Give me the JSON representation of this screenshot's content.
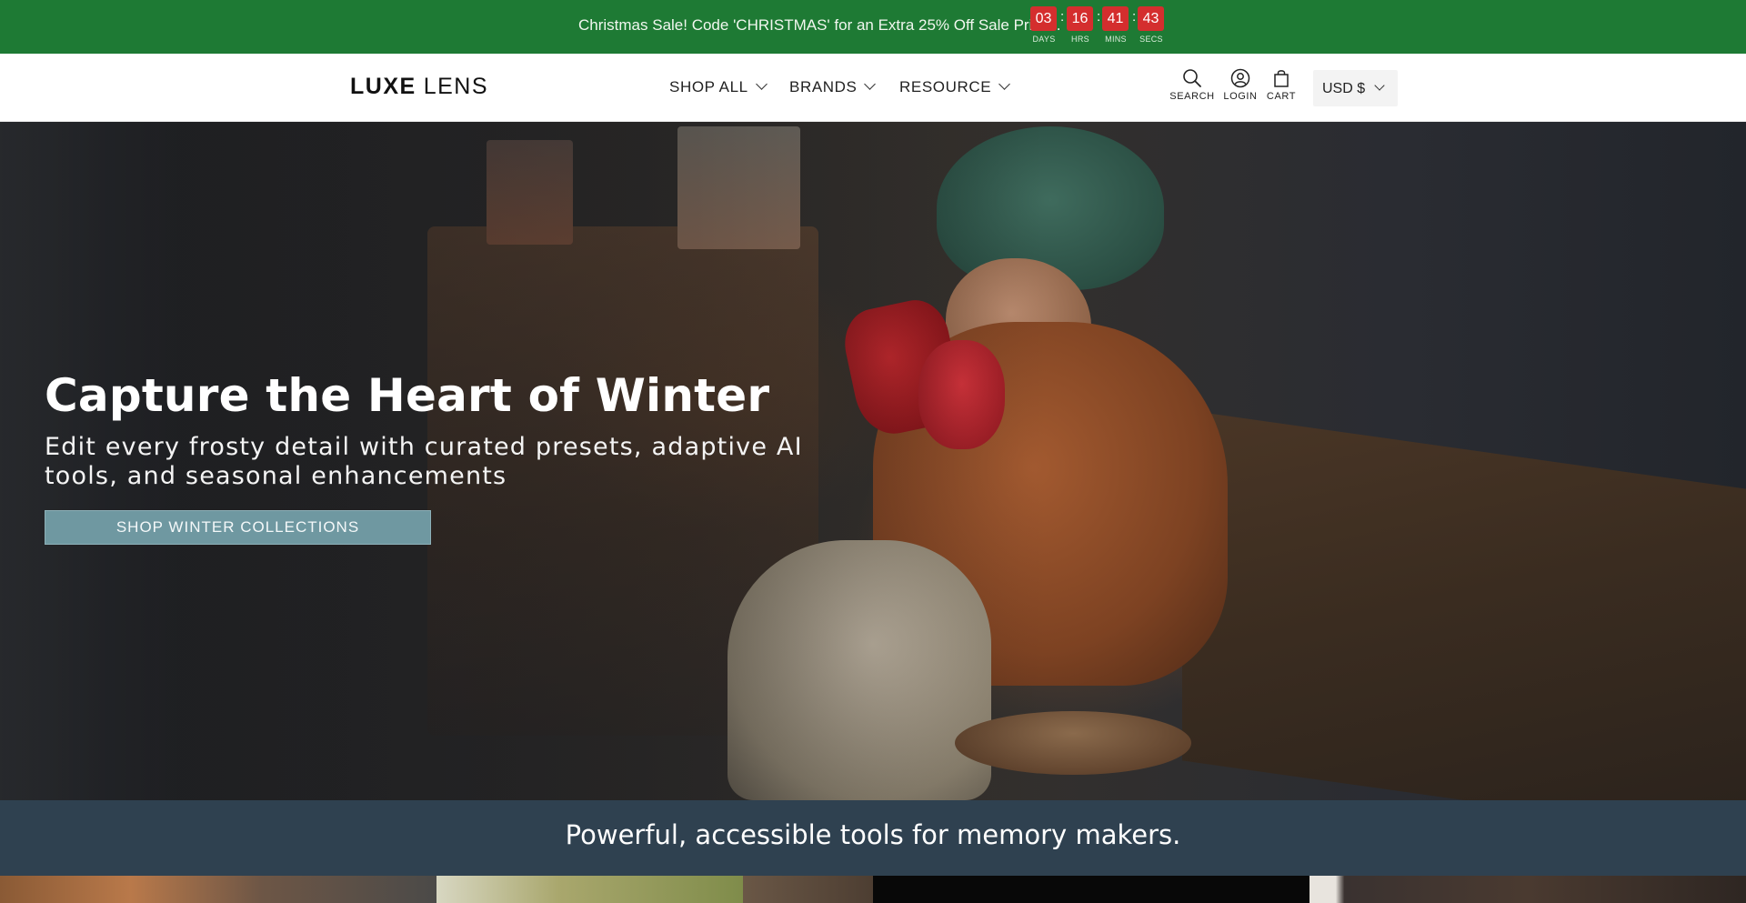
{
  "promo": {
    "text": "Christmas Sale! Code 'CHRISTMAS' for an Extra 25% Off Sale Prices.",
    "countdown": [
      {
        "value": "03",
        "label": "DAYS"
      },
      {
        "value": "16",
        "label": "HRS"
      },
      {
        "value": "41",
        "label": "MINS"
      },
      {
        "value": "43",
        "label": "SECS"
      }
    ],
    "separator": ":",
    "colors": {
      "background": "#1e7a34",
      "countdown_box": "#d42e2e"
    }
  },
  "header": {
    "logo": {
      "part1": "LUXE",
      "part2": "LENS"
    },
    "nav": [
      {
        "label": "SHOP ALL",
        "icon": "chevron-down-icon"
      },
      {
        "label": "BRANDS",
        "icon": "chevron-down-icon"
      },
      {
        "label": "RESOURCE",
        "icon": "chevron-down-icon"
      }
    ],
    "icons": [
      {
        "label": "SEARCH",
        "icon": "search-icon"
      },
      {
        "label": "LOGIN",
        "icon": "user-icon"
      },
      {
        "label": "CART",
        "icon": "shopping-bag-icon"
      }
    ],
    "currency": "USD $"
  },
  "hero": {
    "title": "Capture the Heart of Winter",
    "subtitle": "Edit every frosty detail with curated presets, adaptive AI tools, and seasonal enhancements",
    "cta": "SHOP WINTER COLLECTIONS",
    "colors": {
      "cta": "#6f98a1"
    }
  },
  "band": {
    "text": "Powerful, accessible tools for memory makers.",
    "color": "#2f4150"
  }
}
